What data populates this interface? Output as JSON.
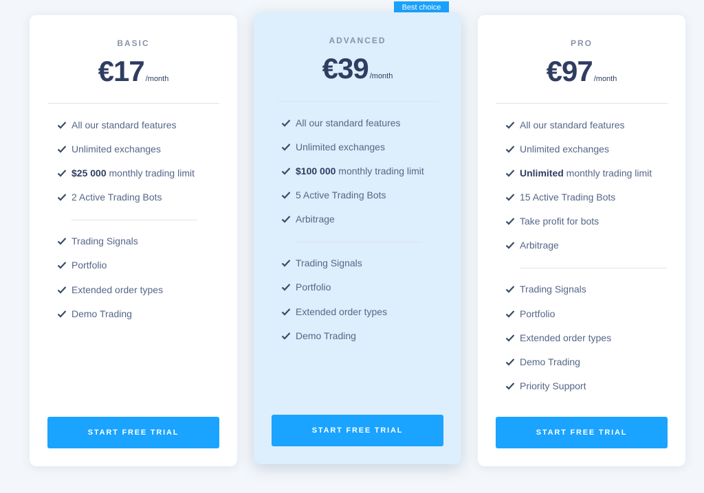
{
  "badge": "Best choice",
  "plans": {
    "basic": {
      "name": "BASIC",
      "price": "€17",
      "period": "/month",
      "features_a": [
        "All our standard features",
        "Unlimited exchanges",
        "monthly trading limit",
        "2 Active Trading Bots"
      ],
      "limit_value": "$25 000",
      "features_b": [
        "Trading Signals",
        "Portfolio",
        "Extended order types",
        "Demo Trading"
      ],
      "cta": "START FREE TRIAL"
    },
    "advanced": {
      "name": "ADVANCED",
      "price": "€39",
      "period": "/month",
      "features_a": [
        "All our standard features",
        "Unlimited exchanges",
        "monthly trading limit",
        "5 Active Trading Bots",
        "Arbitrage"
      ],
      "limit_value": "$100 000",
      "features_b": [
        "Trading Signals",
        "Portfolio",
        "Extended order types",
        "Demo Trading"
      ],
      "cta": "START FREE TRIAL"
    },
    "pro": {
      "name": "PRO",
      "price": "€97",
      "period": "/month",
      "features_a": [
        "All our standard features",
        "Unlimited exchanges",
        "monthly trading limit",
        "15 Active Trading Bots",
        "Take profit for bots",
        "Arbitrage"
      ],
      "limit_value": "Unlimited",
      "features_b": [
        "Trading Signals",
        "Portfolio",
        "Extended order types",
        "Demo Trading",
        "Priority Support"
      ],
      "cta": "START FREE TRIAL"
    }
  },
  "colors": {
    "accent": "#1aa3ff",
    "highlight_card": "#ddeefc",
    "heading": "#2f3d61"
  },
  "icons": {
    "feature": "check-icon"
  }
}
